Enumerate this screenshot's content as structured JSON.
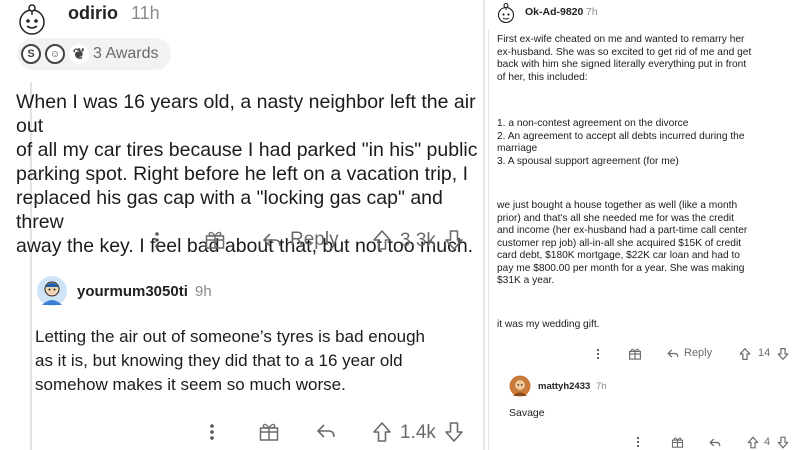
{
  "left": {
    "post": {
      "username": "odirio",
      "time": "11h",
      "awards_label": "3 Awards",
      "award_icons": [
        "silver-award-icon",
        "wholesome-award-icon",
        "helpful-award-icon"
      ],
      "body": "When I was 16 years old, a nasty neighbor left the air out\nof all my car tires because I had parked \"in his\" public\nparking spot.  Right before he left on a vacation trip, I\nreplaced his gas cap with a \"locking gas cap\" and threw\naway the key.  I feel bad about that, but not too much.",
      "reply_label": "Reply",
      "score": "3.3k"
    },
    "reply": {
      "username": "yourmum3050ti",
      "time": "9h",
      "body": "Letting the air out of someone’s tyres is bad enough\nas it is, but knowing they did that to a 16 year old\nsomehow makes it seem so much worse.",
      "score": "1.4k"
    }
  },
  "right": {
    "post": {
      "username": "Ok-Ad-9820",
      "time": "7h",
      "para1": "First ex-wife cheated on me and wanted to remarry her\nex-husband. She was so excited to get rid of me and get\nback with him she signed literally everything put in front\nof her, this included:",
      "list": [
        "1. a non-contest agreement on the divorce",
        "2. An agreement to accept all debts incurred during the\nmarriage",
        "3. A spousal support agreement (for me)"
      ],
      "para2": "we just bought a house together as well (like a month\nprior) and that's all she needed me for was the credit\nand income (her ex-husband had a part-time call center\ncustomer rep job) all-in-all she acquired $15K of credit\ncard debt, $180K mortgage, $22K car loan and had to\npay me $800.00 per month for a year. She was making\n$31K a year.",
      "para3": "it was my wedding gift.",
      "reply_label": "Reply",
      "score": "14"
    },
    "reply": {
      "username": "mattyh2433",
      "time": "7h",
      "body": "Savage",
      "score": "4"
    }
  },
  "colors": {
    "text": "#1c1c1c",
    "muted": "#6a6a6a",
    "divider": "#e6e6e6",
    "avatar_blue": "#3b7fd6",
    "avatar_orange": "#d08a4a"
  }
}
